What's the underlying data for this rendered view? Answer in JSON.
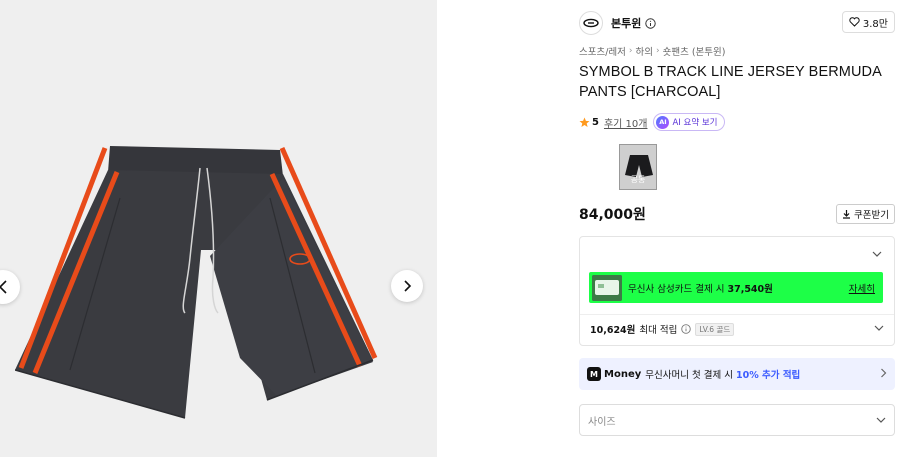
{
  "brand": {
    "name": "본투윈",
    "like_count": "3.8만"
  },
  "breadcrumb": [
    "스포츠/레저",
    "하의",
    "숏팬츠 (본투윈)"
  ],
  "product": {
    "title": "SYMBOL B TRACK LINE JERSEY BERMUDA PANTS [CHARCOAL]",
    "rating": "5",
    "review_link": "후기 10개",
    "ai_summary_label": "AI 요약 보기",
    "ai_badge": "AI",
    "thumb_label": "공통",
    "price": "84,000원",
    "coupon_label": "쿠폰받기"
  },
  "benefits": {
    "card_text_prefix": "무신사 삼성카드 결제 시 ",
    "card_amount": "37,540원",
    "card_detail_link": "자세히",
    "points_amount": "10,624원",
    "points_label": "최대 적립",
    "level_badge": "LV.6 골드"
  },
  "money": {
    "logo": "M",
    "word": "Money",
    "text": "무신사머니 첫 결제 시",
    "highlight": "10% 추가 적립"
  },
  "size_select": {
    "placeholder": "사이즈"
  },
  "colors": {
    "star": "#ff9a1f",
    "card_banner": "#1dff47",
    "money_accent": "#3b5bff",
    "shorts": "#3a3b40",
    "stripe": "#e84b1a"
  }
}
